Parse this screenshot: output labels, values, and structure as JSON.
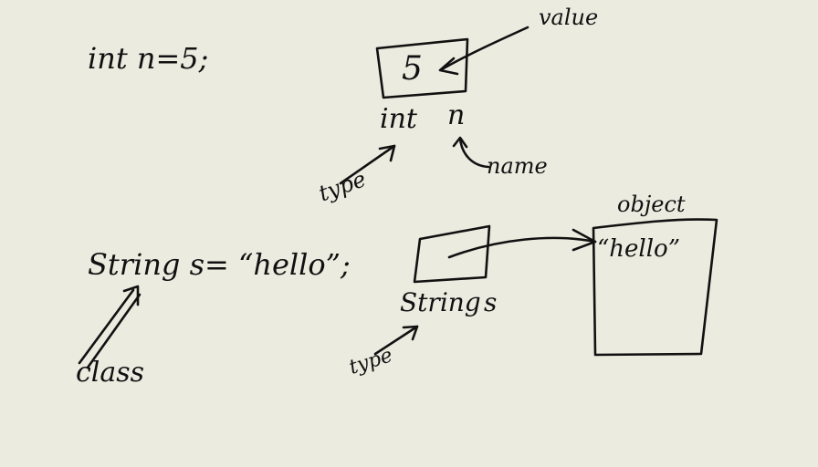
{
  "primitive": {
    "statement": "int n=5;",
    "box_value": "5",
    "type_label": "int",
    "var_name": "n",
    "value_annotation": "value",
    "name_annotation": "name",
    "type_annotation": "type"
  },
  "reference": {
    "statement": "String s= “hello”;",
    "class_annotation": "class",
    "type_label": "String",
    "var_name": "s",
    "type_annotation": "type",
    "object_label": "object",
    "object_value": "“hello”"
  }
}
